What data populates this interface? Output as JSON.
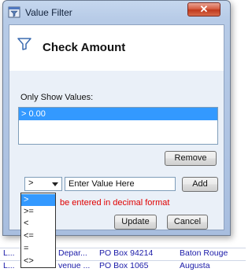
{
  "background_rows": [
    {
      "col1": "",
      "col2": "",
      "col3": "",
      "col4": ""
    },
    {
      "col1": "L...",
      "col2": "Depar...",
      "col3": "PO Box 94214",
      "col4": "Baton Rouge"
    },
    {
      "col1": "L...",
      "col2": "venue ...",
      "col3": "PO Box 1065",
      "col4": "Augusta"
    }
  ],
  "dialog": {
    "title": "Value Filter",
    "close_label": "✕",
    "column_title": "Check Amount",
    "only_show_label": "Only Show Values:",
    "values": [
      "> 0.00"
    ],
    "remove_label": "Remove",
    "operator_selected": ">",
    "value_placeholder": "Enter Value Here",
    "add_label": "Add",
    "error_message": "be entered in decimal format",
    "update_label": "Update",
    "cancel_label": "Cancel"
  },
  "operator_options": [
    ">",
    ">=",
    "<",
    "<=",
    "=",
    "<>"
  ],
  "colors": {
    "selection": "#3399ff",
    "error": "#e00000",
    "link_text": "#1a1aa8"
  },
  "icons": {
    "title": "filter-window-icon",
    "filter": "funnel-icon",
    "dropdown": "chevron-down-icon"
  }
}
